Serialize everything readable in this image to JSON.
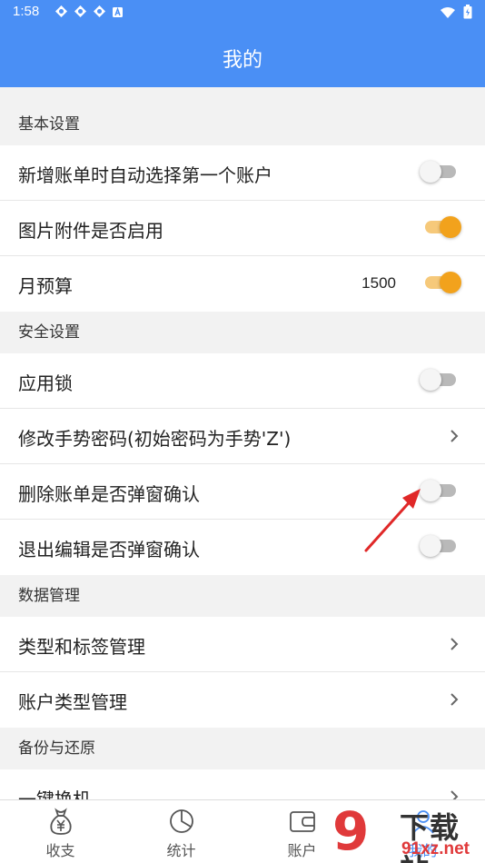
{
  "status_bar": {
    "time": "1:58"
  },
  "app_bar": {
    "title": "我的"
  },
  "sections": {
    "basic": {
      "header": "基本设置",
      "rows": [
        {
          "label": "新增账单时自动选择第一个账户",
          "toggle_on": false
        },
        {
          "label": "图片附件是否启用",
          "toggle_on": true
        },
        {
          "label": "月预算",
          "value": "1500",
          "toggle_on": true
        }
      ]
    },
    "security": {
      "header": "安全设置",
      "rows": [
        {
          "label": "应用锁",
          "toggle_on": false
        },
        {
          "label": "修改手势密码(初始密码为手势'Z')"
        },
        {
          "label": "删除账单是否弹窗确认",
          "toggle_on": false
        },
        {
          "label": "退出编辑是否弹窗确认",
          "toggle_on": false
        }
      ]
    },
    "data": {
      "header": "数据管理",
      "rows": [
        {
          "label": "类型和标签管理"
        },
        {
          "label": "账户类型管理"
        }
      ]
    },
    "backup": {
      "header": "备份与还原",
      "rows": [
        {
          "label": "一键换机"
        }
      ]
    }
  },
  "tabs": [
    {
      "label": "收支",
      "icon": "money-bag-icon"
    },
    {
      "label": "统计",
      "icon": "pie-chart-icon"
    },
    {
      "label": "账户",
      "icon": "wallet-icon"
    },
    {
      "label": "我的",
      "icon": "profile-icon"
    }
  ],
  "watermark": {
    "glyph": "9",
    "text": "下载站",
    "url": "91xz.net"
  },
  "colors": {
    "primary": "#4a8ff5",
    "toggle_on": "#f2a21c",
    "toggle_off": "#b9b9b9",
    "arrow": "#e02828"
  }
}
